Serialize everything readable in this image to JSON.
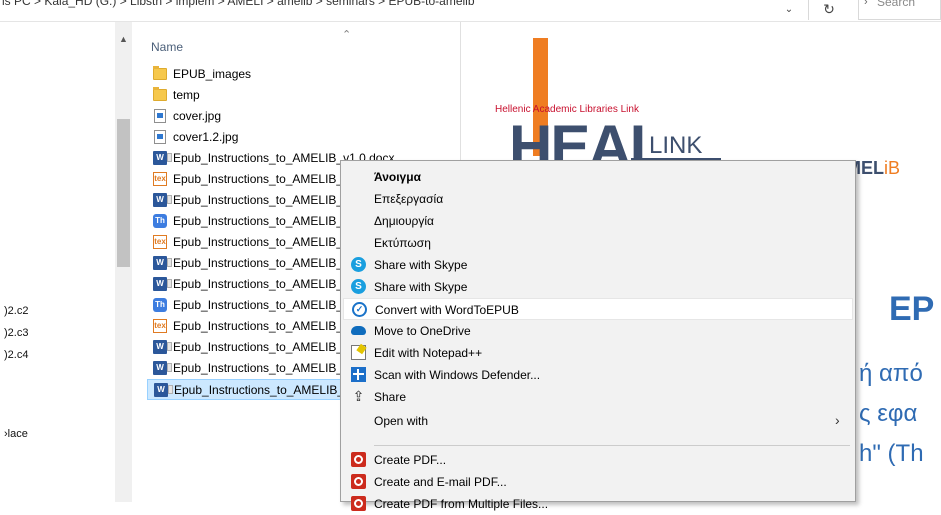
{
  "address_bar": {
    "breadcrumb": "is PC  >  Kala_HD (G:)  >  Libsth  >  implem  >  AMELI  >  amelib  >  seminars  >  EPUB-to-amelib",
    "search_placeholder": "Search"
  },
  "nav_pane": {
    "items": [
      {
        "label": ")2.c2"
      },
      {
        "label": ")2.c3"
      },
      {
        "label": ")2.c4"
      },
      {
        "label": "›lace"
      }
    ]
  },
  "file_list": {
    "column_name": "Name",
    "files": [
      {
        "name": "EPUB_images",
        "icon": "folder-icon"
      },
      {
        "name": "temp",
        "icon": "folder-icon"
      },
      {
        "name": "cover.jpg",
        "icon": "jpg-file-icon"
      },
      {
        "name": "cover1.2.jpg",
        "icon": "jpg-file-icon"
      },
      {
        "name": "Epub_Instructions_to_AMELIB_v1.0.docx",
        "icon": "docx-file-icon"
      },
      {
        "name": "Epub_Instructions_to_AMELIB_v",
        "icon": "tex-file-icon"
      },
      {
        "name": "Epub_Instructions_to_AMELIB_v",
        "icon": "docx-file-icon"
      },
      {
        "name": "Epub_Instructions_to_AMELIB_v",
        "icon": "th-file-icon"
      },
      {
        "name": "Epub_Instructions_to_AMELIB_v",
        "icon": "tex-file-icon"
      },
      {
        "name": "Epub_Instructions_to_AMELIB_v",
        "icon": "docx-file-icon"
      },
      {
        "name": "Epub_Instructions_to_AMELIB_v",
        "icon": "docx-file-icon"
      },
      {
        "name": "Epub_Instructions_to_AMELIB_v",
        "icon": "th-file-icon"
      },
      {
        "name": "Epub_Instructions_to_AMELIB_v",
        "icon": "tex-file-icon"
      },
      {
        "name": "Epub_Instructions_to_AMELIB_v",
        "icon": "docx-file-icon"
      },
      {
        "name": "Epub_Instructions_to_AMELIB_v",
        "icon": "docx-file-icon"
      },
      {
        "name": "Epub_Instructions_to_AMELIB_v",
        "icon": "docx-file-icon",
        "selected": true
      }
    ],
    "icon_badges": {
      "docx": "W",
      "tex": "tex",
      "th": "Th"
    }
  },
  "preview": {
    "logo_subtitle": "Hellenic Academic Libraries Link",
    "logo_heal": "HEAL",
    "logo_link": "LINK",
    "amelib_prefix": "AMEL",
    "amelib_suffix": "iB",
    "heading": "EP",
    "line1": "ή από",
    "line2": "ς εφα",
    "line3": "h\" (Th"
  },
  "context_menu": {
    "items": [
      {
        "label": "Άνοιγμα",
        "icon": "",
        "bold": true
      },
      {
        "label": "Επεξεργασία",
        "icon": ""
      },
      {
        "label": "Δημιουργία",
        "icon": ""
      },
      {
        "label": "Εκτύπωση",
        "icon": ""
      },
      {
        "label": "Share with Skype",
        "icon": "skype-icon"
      },
      {
        "label": "Share with Skype",
        "icon": "skype-icon"
      },
      {
        "label": "Convert with WordToEPUB",
        "icon": "wordtoepub-icon",
        "hover": true
      },
      {
        "label": "Move to OneDrive",
        "icon": "onedrive-icon"
      },
      {
        "label": "Edit with Notepad++",
        "icon": "notepad-plus-plus-icon"
      },
      {
        "label": "Scan with Windows Defender...",
        "icon": "windows-defender-icon"
      },
      {
        "label": "Share",
        "icon": "share-icon"
      },
      {
        "label": "Open with",
        "icon": "",
        "submenu": true
      },
      {
        "label": "Create PDF...",
        "icon": "acrobat-pdf-icon"
      },
      {
        "label": "Create and E-mail PDF...",
        "icon": "acrobat-pdf-icon"
      },
      {
        "label": "Create PDF from Multiple Files...",
        "icon": "acrobat-pdf-icon"
      }
    ],
    "skype_glyph": "S",
    "share_glyph": "⇪",
    "submenu_arrow": "›"
  },
  "colors": {
    "selection": "#cce8ff",
    "menu_background": "#f2f2f2",
    "heal_orange": "#ef7d22",
    "heal_navy": "#3d4f6e",
    "doc_blue": "#2f6bb3"
  }
}
